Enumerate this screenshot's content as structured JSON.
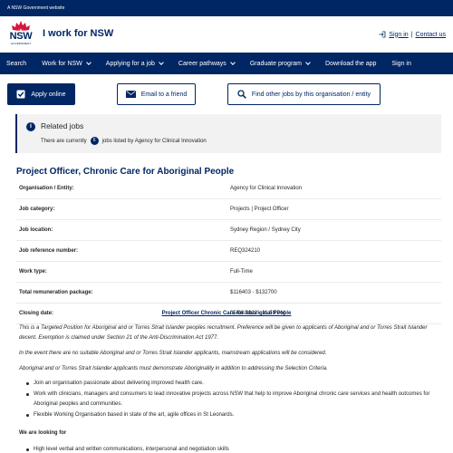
{
  "gov_strip": {
    "text": "A NSW Government website"
  },
  "header": {
    "logo_text": "NSW",
    "logo_sub": "GOVERNMENT",
    "site_name": "I work for NSW",
    "sign_in": "Sign in",
    "separator": "|",
    "contact_us": "Contact us"
  },
  "nav": {
    "items": [
      {
        "label": "Search"
      },
      {
        "label": "Work for NSW"
      },
      {
        "label": "Applying for a job"
      },
      {
        "label": "Career pathways"
      },
      {
        "label": "Graduate program"
      },
      {
        "label": "Download the app"
      },
      {
        "label": "Sign in"
      }
    ]
  },
  "actions": {
    "apply": "Apply online",
    "email": "Email to a friend",
    "other": "Find other jobs by this organisation / entity"
  },
  "related": {
    "title": "Related jobs",
    "prefix": "There are currently",
    "count": "6",
    "suffix": "jobs listed by Agency for Clinical Innovation"
  },
  "job": {
    "title": "Project Officer, Chronic Care for Aboriginal People",
    "details": [
      {
        "label": "Organisation / Entity:",
        "value": "Agency for Clinical Innovation"
      },
      {
        "label": "Job category:",
        "value": "Projects | Project Officer"
      },
      {
        "label": "Job location:",
        "value": "Sydney Region / Sydney City"
      },
      {
        "label": "Job reference number:",
        "value": "REQ324210"
      },
      {
        "label": "Work type:",
        "value": "Full-Time"
      },
      {
        "label": "Total remuneration package:",
        "value": "$116403 - $132700"
      },
      {
        "label": "Closing date:",
        "value": "05/08/2022 - 11:59 PM"
      }
    ]
  },
  "body": {
    "heading_link": "Project Officer Chronic Care for Aboriginal People",
    "para1": "This is a Targeted Position for Aboriginal and or Torres Strait Islander peoples recruitment. Preference will be given to applicants of Aboriginal and or Torres Strait Islander decent. Exemption is claimed under Section 21 of the Anti-Discrimination Act 1977.",
    "para2": "In the event there are no suitable Aboriginal and or Torres Strait Islander applicants, mainstream applications will be considered.",
    "para3": "Aboriginal and or Torres Strait Islander applicants must demonstrate Aboriginality in addition to addressing the Selection Criteria.",
    "bullets": [
      "Join an organisation passionate about delivering improved health care.",
      "Work with clinicians, managers and consumers to lead innovative projects across NSW that help to improve Aboriginal chronic care services and health outcomes for Aboriginal peoples and communities.",
      "Flexible Working Organisation based in state of the art, agile offices in St Leonards."
    ],
    "looking_for": "We are looking for",
    "looking_bullets": [
      "High level verbal and written communications, interpersonal and negotiation skills"
    ]
  },
  "colors": {
    "navy": "#002664",
    "red": "#d7153a",
    "panel": "#f2f2f2"
  }
}
